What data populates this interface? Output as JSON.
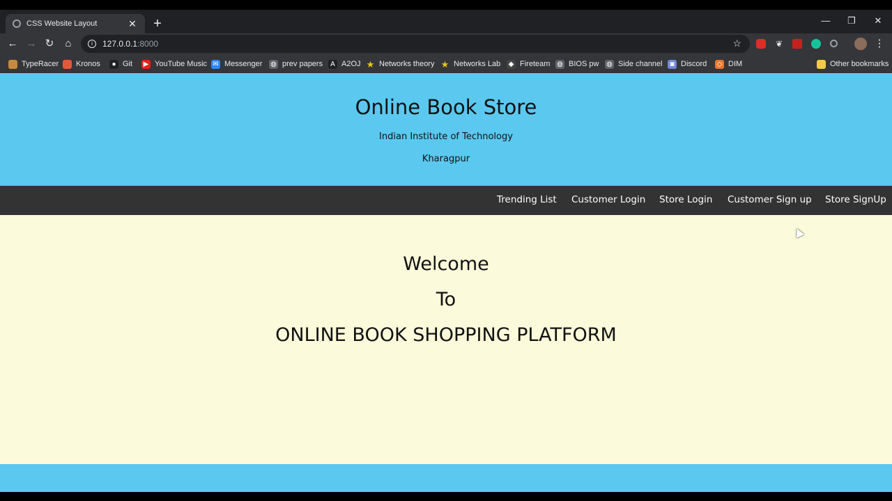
{
  "browser": {
    "tab": {
      "title": "CSS Website Layout"
    },
    "window_controls": {
      "minimize": "—",
      "restore": "❐",
      "close": "✕"
    },
    "new_tab_label": "+",
    "address_bar": {
      "host": "127.0.0.1",
      "port": ":8000"
    },
    "bookmarks": [
      {
        "label": "TypeRacer",
        "icon": "typeracer-icon",
        "color": "#c58a3a"
      },
      {
        "label": "Kronos",
        "icon": "kronos-icon",
        "color": "#e05a3a"
      },
      {
        "label": "Git",
        "icon": "github-icon",
        "color": "#202124"
      },
      {
        "label": "YouTube Music",
        "icon": "youtube-music-icon",
        "color": "#e62117"
      },
      {
        "label": "Messenger",
        "icon": "messenger-icon",
        "color": "#2d88ff"
      },
      {
        "label": "prev papers",
        "icon": "globe-icon",
        "color": "#5f6368"
      },
      {
        "label": "A2OJ",
        "icon": "a2oj-icon",
        "color": "#202124"
      },
      {
        "label": "Networks theory",
        "icon": "star-icon",
        "color": "#e6c619"
      },
      {
        "label": "Networks Lab",
        "icon": "star-icon",
        "color": "#e6c619"
      },
      {
        "label": "Fireteam",
        "icon": "shield-icon",
        "color": "#444"
      },
      {
        "label": "BIOS pw",
        "icon": "globe-icon",
        "color": "#5f6368"
      },
      {
        "label": "Side channel",
        "icon": "globe-icon",
        "color": "#5f6368"
      },
      {
        "label": "Discord",
        "icon": "discord-icon",
        "color": "#7289da"
      },
      {
        "label": "DIM",
        "icon": "dim-icon",
        "color": "#e8772e"
      }
    ],
    "other_bookmarks": "Other bookmarks",
    "folder_color": "#f2c94c"
  },
  "site": {
    "title": "Online Book Store",
    "subtitle_line1": "Indian Institute of Technology",
    "subtitle_line2": "Kharagpur",
    "nav": [
      "Trending List",
      "Customer Login",
      "Store Login",
      "Customer Sign up",
      "Store SignUp"
    ],
    "welcome": {
      "line1": "Welcome",
      "line2": "To",
      "line3": "ONLINE BOOK SHOPPING PLATFORM"
    },
    "colors": {
      "header": "#5bc8ef",
      "navbar": "#333333",
      "body": "#fbfada"
    }
  }
}
